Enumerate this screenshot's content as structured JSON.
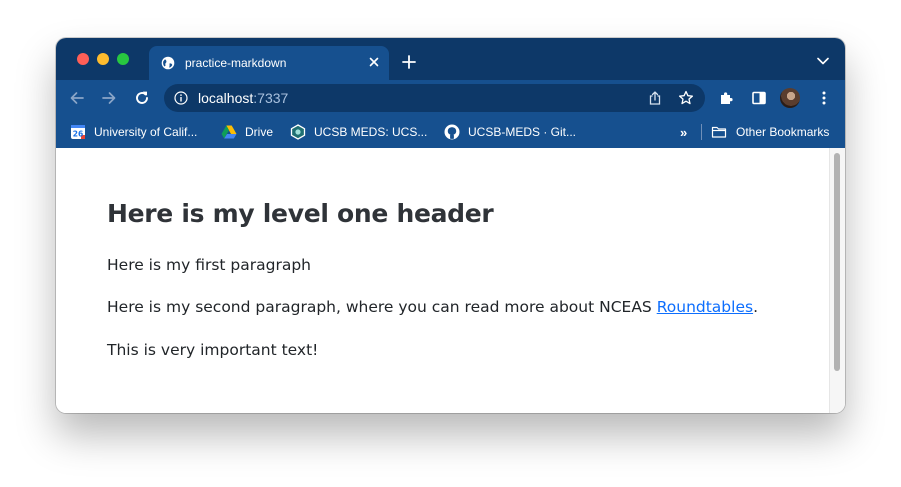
{
  "window": {
    "tab": {
      "title": "practice-markdown"
    },
    "address_bar": {
      "host": "localhost",
      "port": ":7337"
    }
  },
  "bookmarks": [
    {
      "label": "University of Calif...",
      "icon": "google-calendar-icon"
    },
    {
      "label": "Drive",
      "icon": "google-drive-icon"
    },
    {
      "label": "UCSB MEDS: UCS...",
      "icon": "ucsb-meds-icon"
    },
    {
      "label": "UCSB-MEDS · Git...",
      "icon": "github-icon"
    }
  ],
  "bookmarks_overflow": "»",
  "other_bookmarks": {
    "label": "Other Bookmarks",
    "icon": "folder-icon"
  },
  "page": {
    "heading": "Here is my level one header",
    "paragraph1": "Here is my first paragraph",
    "paragraph2_prefix": "Here is my second paragraph, where you can read more about NCEAS ",
    "paragraph2_link": "Roundtables",
    "paragraph2_suffix": ".",
    "paragraph3": "This is very important text!"
  },
  "colors": {
    "tabstrip": "#0d3868",
    "toolbar": "#16508f",
    "link": "#0d6efd",
    "heading": "#2f3338"
  }
}
